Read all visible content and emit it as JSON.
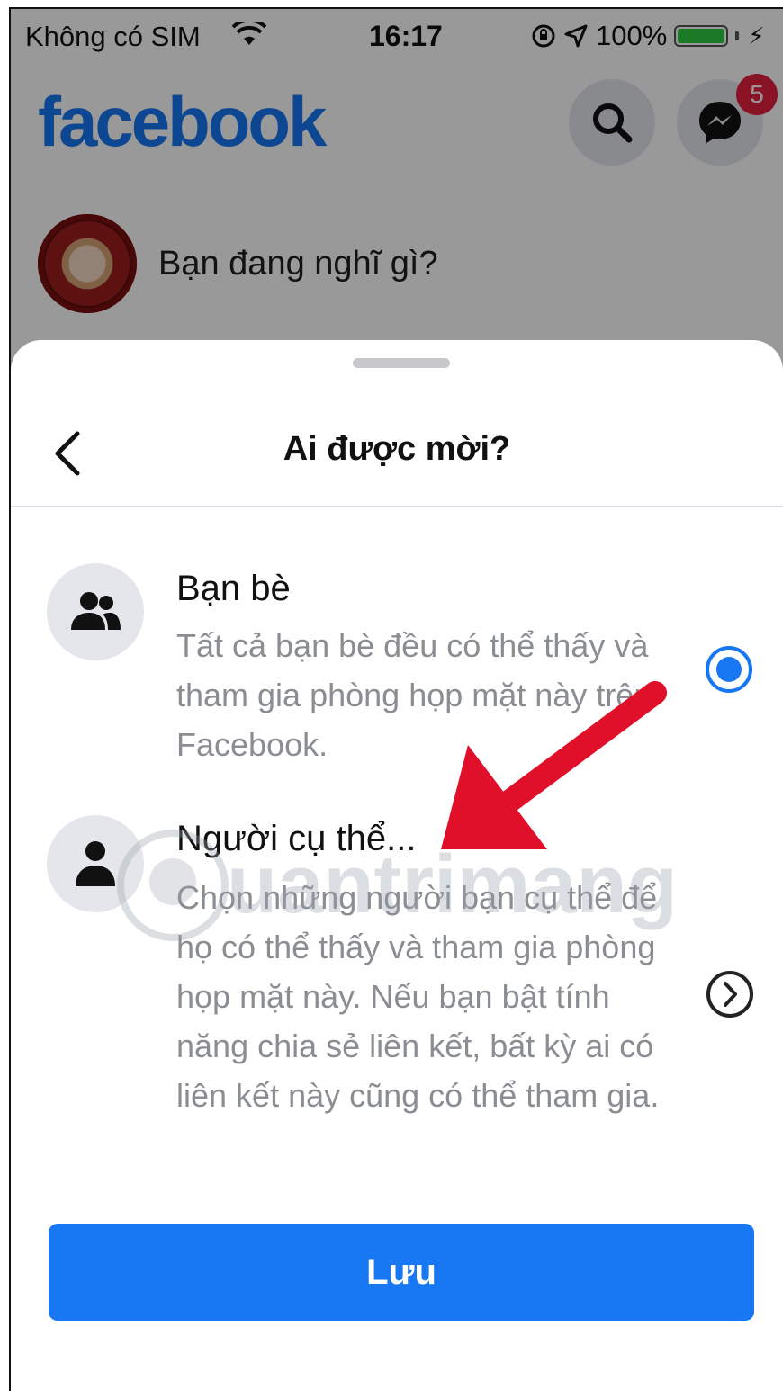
{
  "status_bar": {
    "carrier": "Không có SIM",
    "time": "16:17",
    "battery": "100%"
  },
  "header": {
    "logo": "facebook",
    "messenger_badge": "5"
  },
  "composer": {
    "placeholder": "Bạn đang nghĩ gì?"
  },
  "sheet": {
    "title": "Ai được mời?",
    "options": [
      {
        "title": "Bạn bè",
        "desc": "Tất cả bạn bè đều có thể thấy và tham gia phòng họp mặt này trên Facebook.",
        "selected": true
      },
      {
        "title": "Người cụ thể...",
        "desc": "Chọn những người bạn cụ thể để họ có thể thấy và tham gia phòng họp mặt này. Nếu bạn bật tính năng chia sẻ liên kết, bất kỳ ai có liên kết này cũng có thể tham gia.",
        "selected": false
      }
    ],
    "save_label": "Lưu"
  },
  "watermark": "Quantrimang",
  "colors": {
    "brand": "#1877f2",
    "annotation_arrow": "#e0102a",
    "badge": "#e41e3f"
  },
  "icons": [
    "wifi-icon",
    "lock-rotation-icon",
    "location-arrow-icon",
    "battery-icon",
    "search-icon",
    "messenger-icon",
    "back-chevron-icon",
    "friends-icon",
    "person-icon",
    "radio-selected-icon",
    "chevron-right-circle-icon"
  ]
}
